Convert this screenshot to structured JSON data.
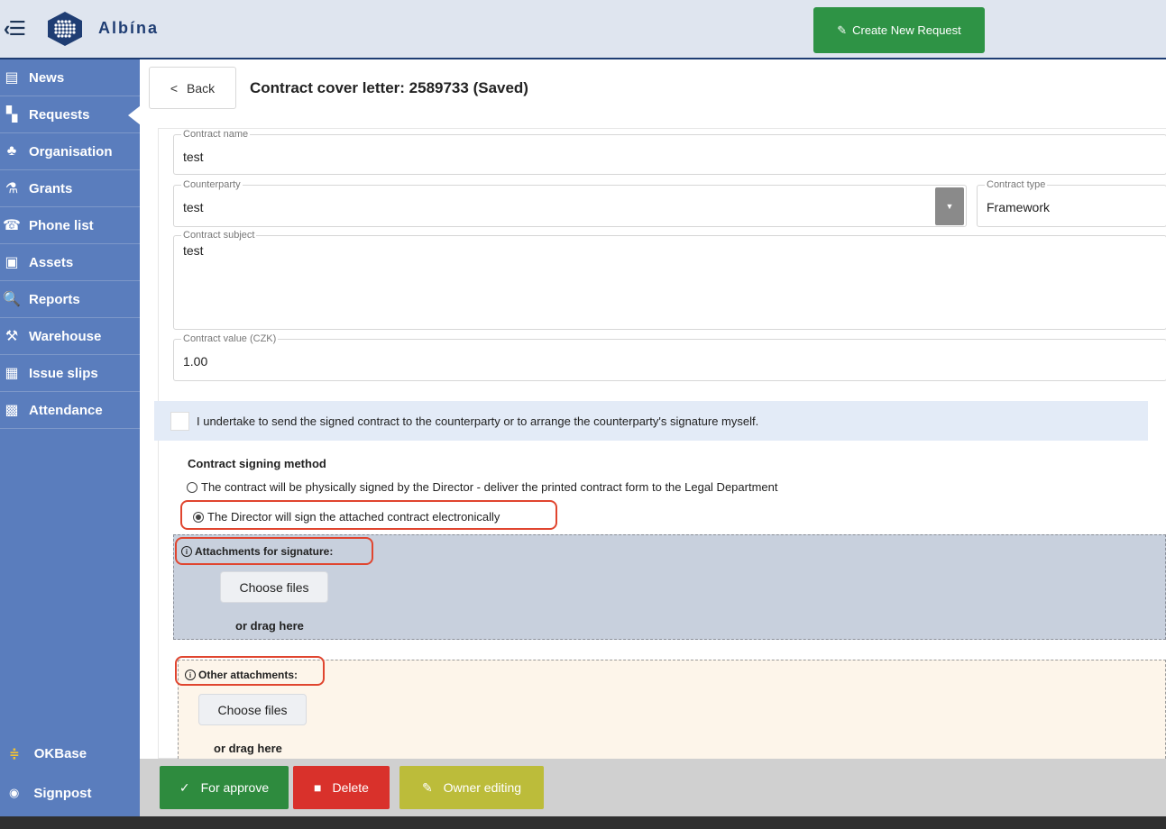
{
  "app": {
    "brand": "Albína"
  },
  "header": {
    "create_request_label": "Create New Request"
  },
  "sidebar": {
    "items": [
      {
        "label": "News",
        "icon": "newspaper-icon",
        "glyph": "▤"
      },
      {
        "label": "Requests",
        "icon": "requests-icon",
        "glyph": "▚"
      },
      {
        "label": "Organisation",
        "icon": "sitemap-icon",
        "glyph": "♣"
      },
      {
        "label": "Grants",
        "icon": "flask-icon",
        "glyph": "⚗"
      },
      {
        "label": "Phone list",
        "icon": "phone-icon",
        "glyph": "☎"
      },
      {
        "label": "Assets",
        "icon": "briefcase-icon",
        "glyph": "▣"
      },
      {
        "label": "Reports",
        "icon": "search-icon",
        "glyph": "🔍"
      },
      {
        "label": "Warehouse",
        "icon": "people-carry-icon",
        "glyph": "⚒"
      },
      {
        "label": "Issue slips",
        "icon": "receipt-icon",
        "glyph": "▦"
      },
      {
        "label": "Attendance",
        "icon": "calendar-icon",
        "glyph": "▩"
      }
    ],
    "active_index": 1,
    "bottom": [
      {
        "label": "OKBase",
        "icon": "okbase-icon"
      },
      {
        "label": "Signpost",
        "icon": "globe-icon"
      }
    ]
  },
  "page": {
    "back_label": "Back",
    "title": "Contract cover letter: 2589733 (Saved)"
  },
  "form": {
    "contract_name": {
      "label": "Contract name",
      "value": "test"
    },
    "counterparty": {
      "label": "Counterparty",
      "value": "test"
    },
    "contract_type": {
      "label": "Contract type",
      "value": "Framework"
    },
    "contract_subject": {
      "label": "Contract subject",
      "value": "test"
    },
    "contract_value": {
      "label": "Contract value (CZK)",
      "value": "1.00"
    },
    "undertake_text": "I undertake to send the signed contract to the counterparty or to arrange the counterparty's signature myself.",
    "undertake_checked": false,
    "signing": {
      "title": "Contract signing method",
      "option_physical": "The contract will be physically signed by the Director - deliver the printed contract form to the Legal Department",
      "option_electronic": "The Director will sign the attached contract electronically",
      "selected": "electronic"
    },
    "attachments_signature": {
      "title": "Attachments for signature:",
      "choose_label": "Choose files",
      "drag_label": "or drag here"
    },
    "attachments_other": {
      "title": "Other attachments:",
      "choose_label": "Choose files",
      "drag_label": "or drag here"
    }
  },
  "footer": {
    "approve_label": "For approve",
    "delete_label": "Delete",
    "owner_label": "Owner editing"
  },
  "colors": {
    "approve": "#2e8b3e",
    "delete": "#d9312b",
    "owner": "#bcbc3a",
    "sidebar": "#5a7dbd",
    "highlight": "#e0452f"
  }
}
